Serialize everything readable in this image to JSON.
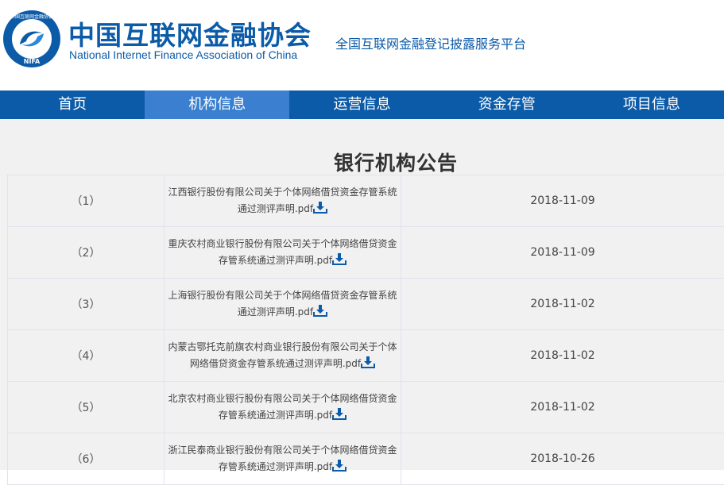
{
  "header": {
    "org_cn": "中国互联网金融协会",
    "org_en": "National Internet Finance Association of China",
    "platform": "全国互联网金融登记披露服务平台",
    "logo": {
      "text_top": "中国互联网金融协会",
      "text_bottom": "NIFA"
    },
    "brand_color": "#0c5ba8"
  },
  "nav": {
    "items": [
      {
        "label": "首页"
      },
      {
        "label": "机构信息"
      },
      {
        "label": "运营信息"
      },
      {
        "label": "资金存管"
      },
      {
        "label": "项目信息"
      }
    ],
    "active_index": 1
  },
  "page": {
    "title": "银行机构公告"
  },
  "announcements": [
    {
      "num": "（1）",
      "name": "江西银行股份有限公司关于个体网络借贷资金存管系统通过测评声明.pdf",
      "date": "2018-11-09"
    },
    {
      "num": "（2）",
      "name": "重庆农村商业银行股份有限公司关于个体网络借贷资金存管系统通过测评声明.pdf",
      "date": "2018-11-09"
    },
    {
      "num": "（3）",
      "name": "上海银行股份有限公司关于个体网络借贷资金存管系统通过测评声明.pdf",
      "date": "2018-11-02"
    },
    {
      "num": "（4）",
      "name": "内蒙古鄂托克前旗农村商业银行股份有限公司关于个体网络借贷资金存管系统通过测评声明.pdf",
      "date": "2018-11-02"
    },
    {
      "num": "（5）",
      "name": "北京农村商业银行股份有限公司关于个体网络借贷资金存管系统通过测评声明.pdf",
      "date": "2018-11-02"
    },
    {
      "num": "（6）",
      "name": "浙江民泰商业银行股份有限公司关于个体网络借贷资金存管系统通过测评声明.pdf",
      "date": "2018-10-26"
    }
  ]
}
